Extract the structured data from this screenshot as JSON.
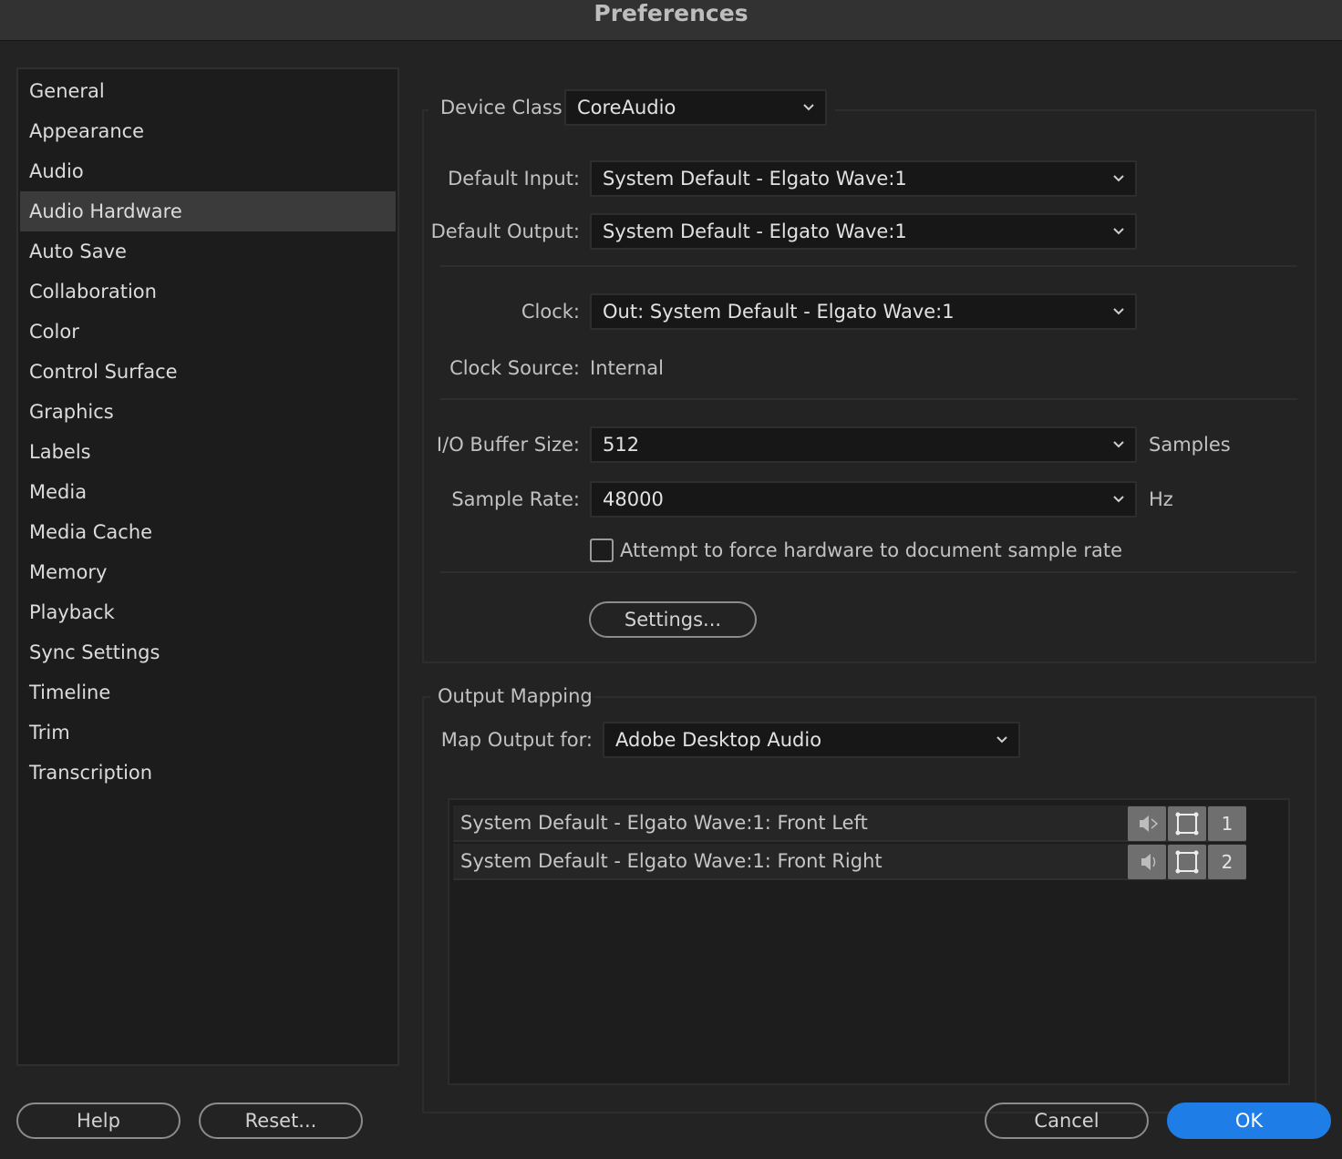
{
  "window": {
    "title": "Preferences"
  },
  "sidebar": {
    "selected": "Audio Hardware",
    "items": [
      {
        "label": "General"
      },
      {
        "label": "Appearance"
      },
      {
        "label": "Audio"
      },
      {
        "label": "Audio Hardware"
      },
      {
        "label": "Auto Save"
      },
      {
        "label": "Collaboration"
      },
      {
        "label": "Color"
      },
      {
        "label": "Control Surface"
      },
      {
        "label": "Graphics"
      },
      {
        "label": "Labels"
      },
      {
        "label": "Media"
      },
      {
        "label": "Media Cache"
      },
      {
        "label": "Memory"
      },
      {
        "label": "Playback"
      },
      {
        "label": "Sync Settings"
      },
      {
        "label": "Timeline"
      },
      {
        "label": "Trim"
      },
      {
        "label": "Transcription"
      }
    ]
  },
  "device": {
    "device_class_label": "Device Class:",
    "device_class_value": "CoreAudio",
    "default_input_label": "Default Input:",
    "default_input_value": "System Default - Elgato Wave:1",
    "default_output_label": "Default Output:",
    "default_output_value": "System Default - Elgato Wave:1",
    "clock_label": "Clock:",
    "clock_value": "Out: System Default - Elgato Wave:1",
    "clock_source_label": "Clock Source:",
    "clock_source_value": "Internal",
    "buffer_size_label": "I/O Buffer Size:",
    "buffer_size_value": "512",
    "buffer_size_unit": "Samples",
    "sample_rate_label": "Sample Rate:",
    "sample_rate_value": "48000",
    "sample_rate_unit": "Hz",
    "force_rate_label": "Attempt to force hardware to document sample rate",
    "force_rate_checked": false,
    "settings_button": "Settings..."
  },
  "output_mapping": {
    "group_label": "Output Mapping",
    "map_output_label": "Map Output for:",
    "map_output_value": "Adobe Desktop Audio",
    "rows": [
      {
        "name": "System Default - Elgato Wave:1: Front Left",
        "channel": "1"
      },
      {
        "name": "System Default - Elgato Wave:1: Front Right",
        "channel": "2"
      }
    ]
  },
  "footer": {
    "help": "Help",
    "reset": "Reset...",
    "cancel": "Cancel",
    "ok": "OK"
  },
  "colors": {
    "background": "#232323",
    "panel": "#1c1c1c",
    "selected_item": "#3b3b3b",
    "accent": "#1e7de6"
  }
}
